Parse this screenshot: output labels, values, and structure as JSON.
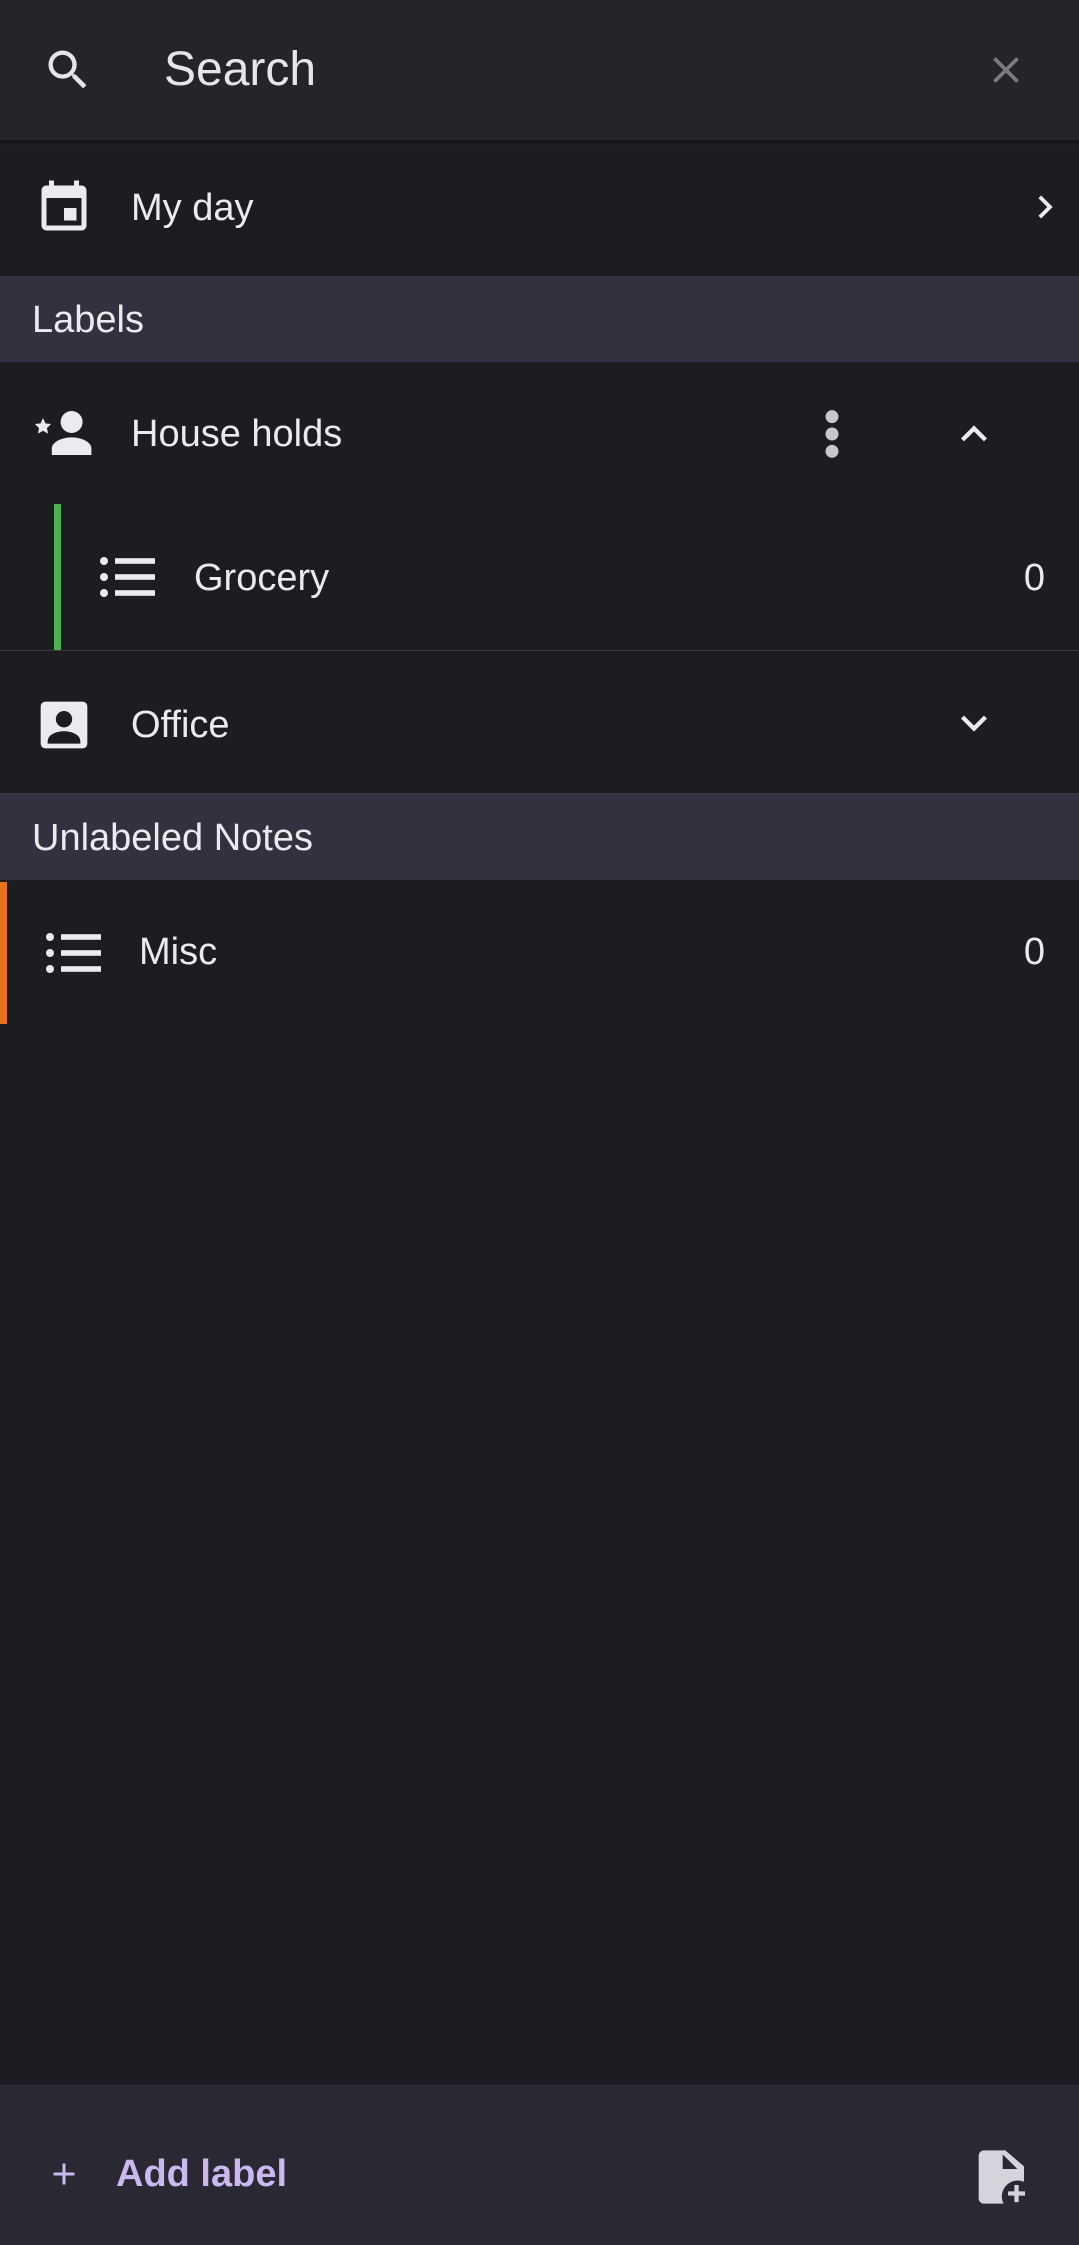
{
  "search": {
    "placeholder": "Search",
    "icon": "search-icon",
    "close_icon": "close-icon"
  },
  "my_day": {
    "label": "My day",
    "icon": "calendar-icon",
    "chevron": "chevron-right-icon"
  },
  "labels_section": {
    "title": "Labels"
  },
  "labels": [
    {
      "name": "House holds",
      "icon": "person-star-icon",
      "expanded": true,
      "lists": [
        {
          "name": "Grocery",
          "count": "0",
          "accent": "#4caf50",
          "icon": "list-icon"
        }
      ]
    },
    {
      "name": "Office",
      "icon": "contact-card-icon",
      "expanded": false,
      "lists": []
    }
  ],
  "unlabeled_section": {
    "title": "Unlabeled Notes"
  },
  "unlabeled": [
    {
      "name": "Misc",
      "count": "0",
      "accent": "#e8731f",
      "icon": "list-icon"
    }
  ],
  "footer": {
    "add_label": "Add label",
    "add_note_icon": "add-note-icon"
  },
  "colors": {
    "background": "#1d1c21",
    "header_band": "#33303f",
    "accent_text": "#cbb8ef"
  }
}
